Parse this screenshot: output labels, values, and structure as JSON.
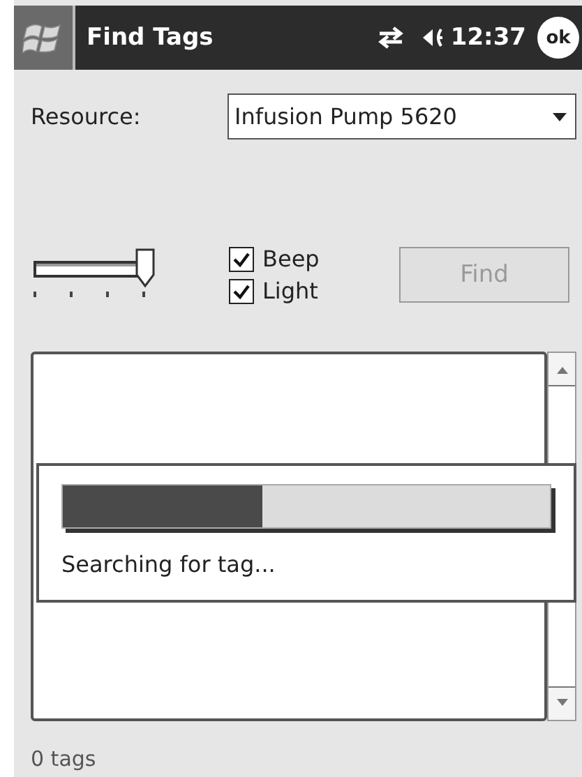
{
  "title_bar": {
    "title": "Find Tags",
    "time": "12:37",
    "ok_button": "ok"
  },
  "resource": {
    "label": "Resource:",
    "value": "Infusion Pump 5620"
  },
  "volume_slider": {
    "level": 1
  },
  "options": [
    {
      "label": "Beep",
      "checked": true
    },
    {
      "label": "Light",
      "checked": true
    }
  ],
  "find_button": {
    "label": "Find",
    "disabled": true
  },
  "progress_dialog": {
    "level": 0.41,
    "message": "Searching for tag..."
  },
  "status_bar": {
    "text": "0 tags"
  }
}
